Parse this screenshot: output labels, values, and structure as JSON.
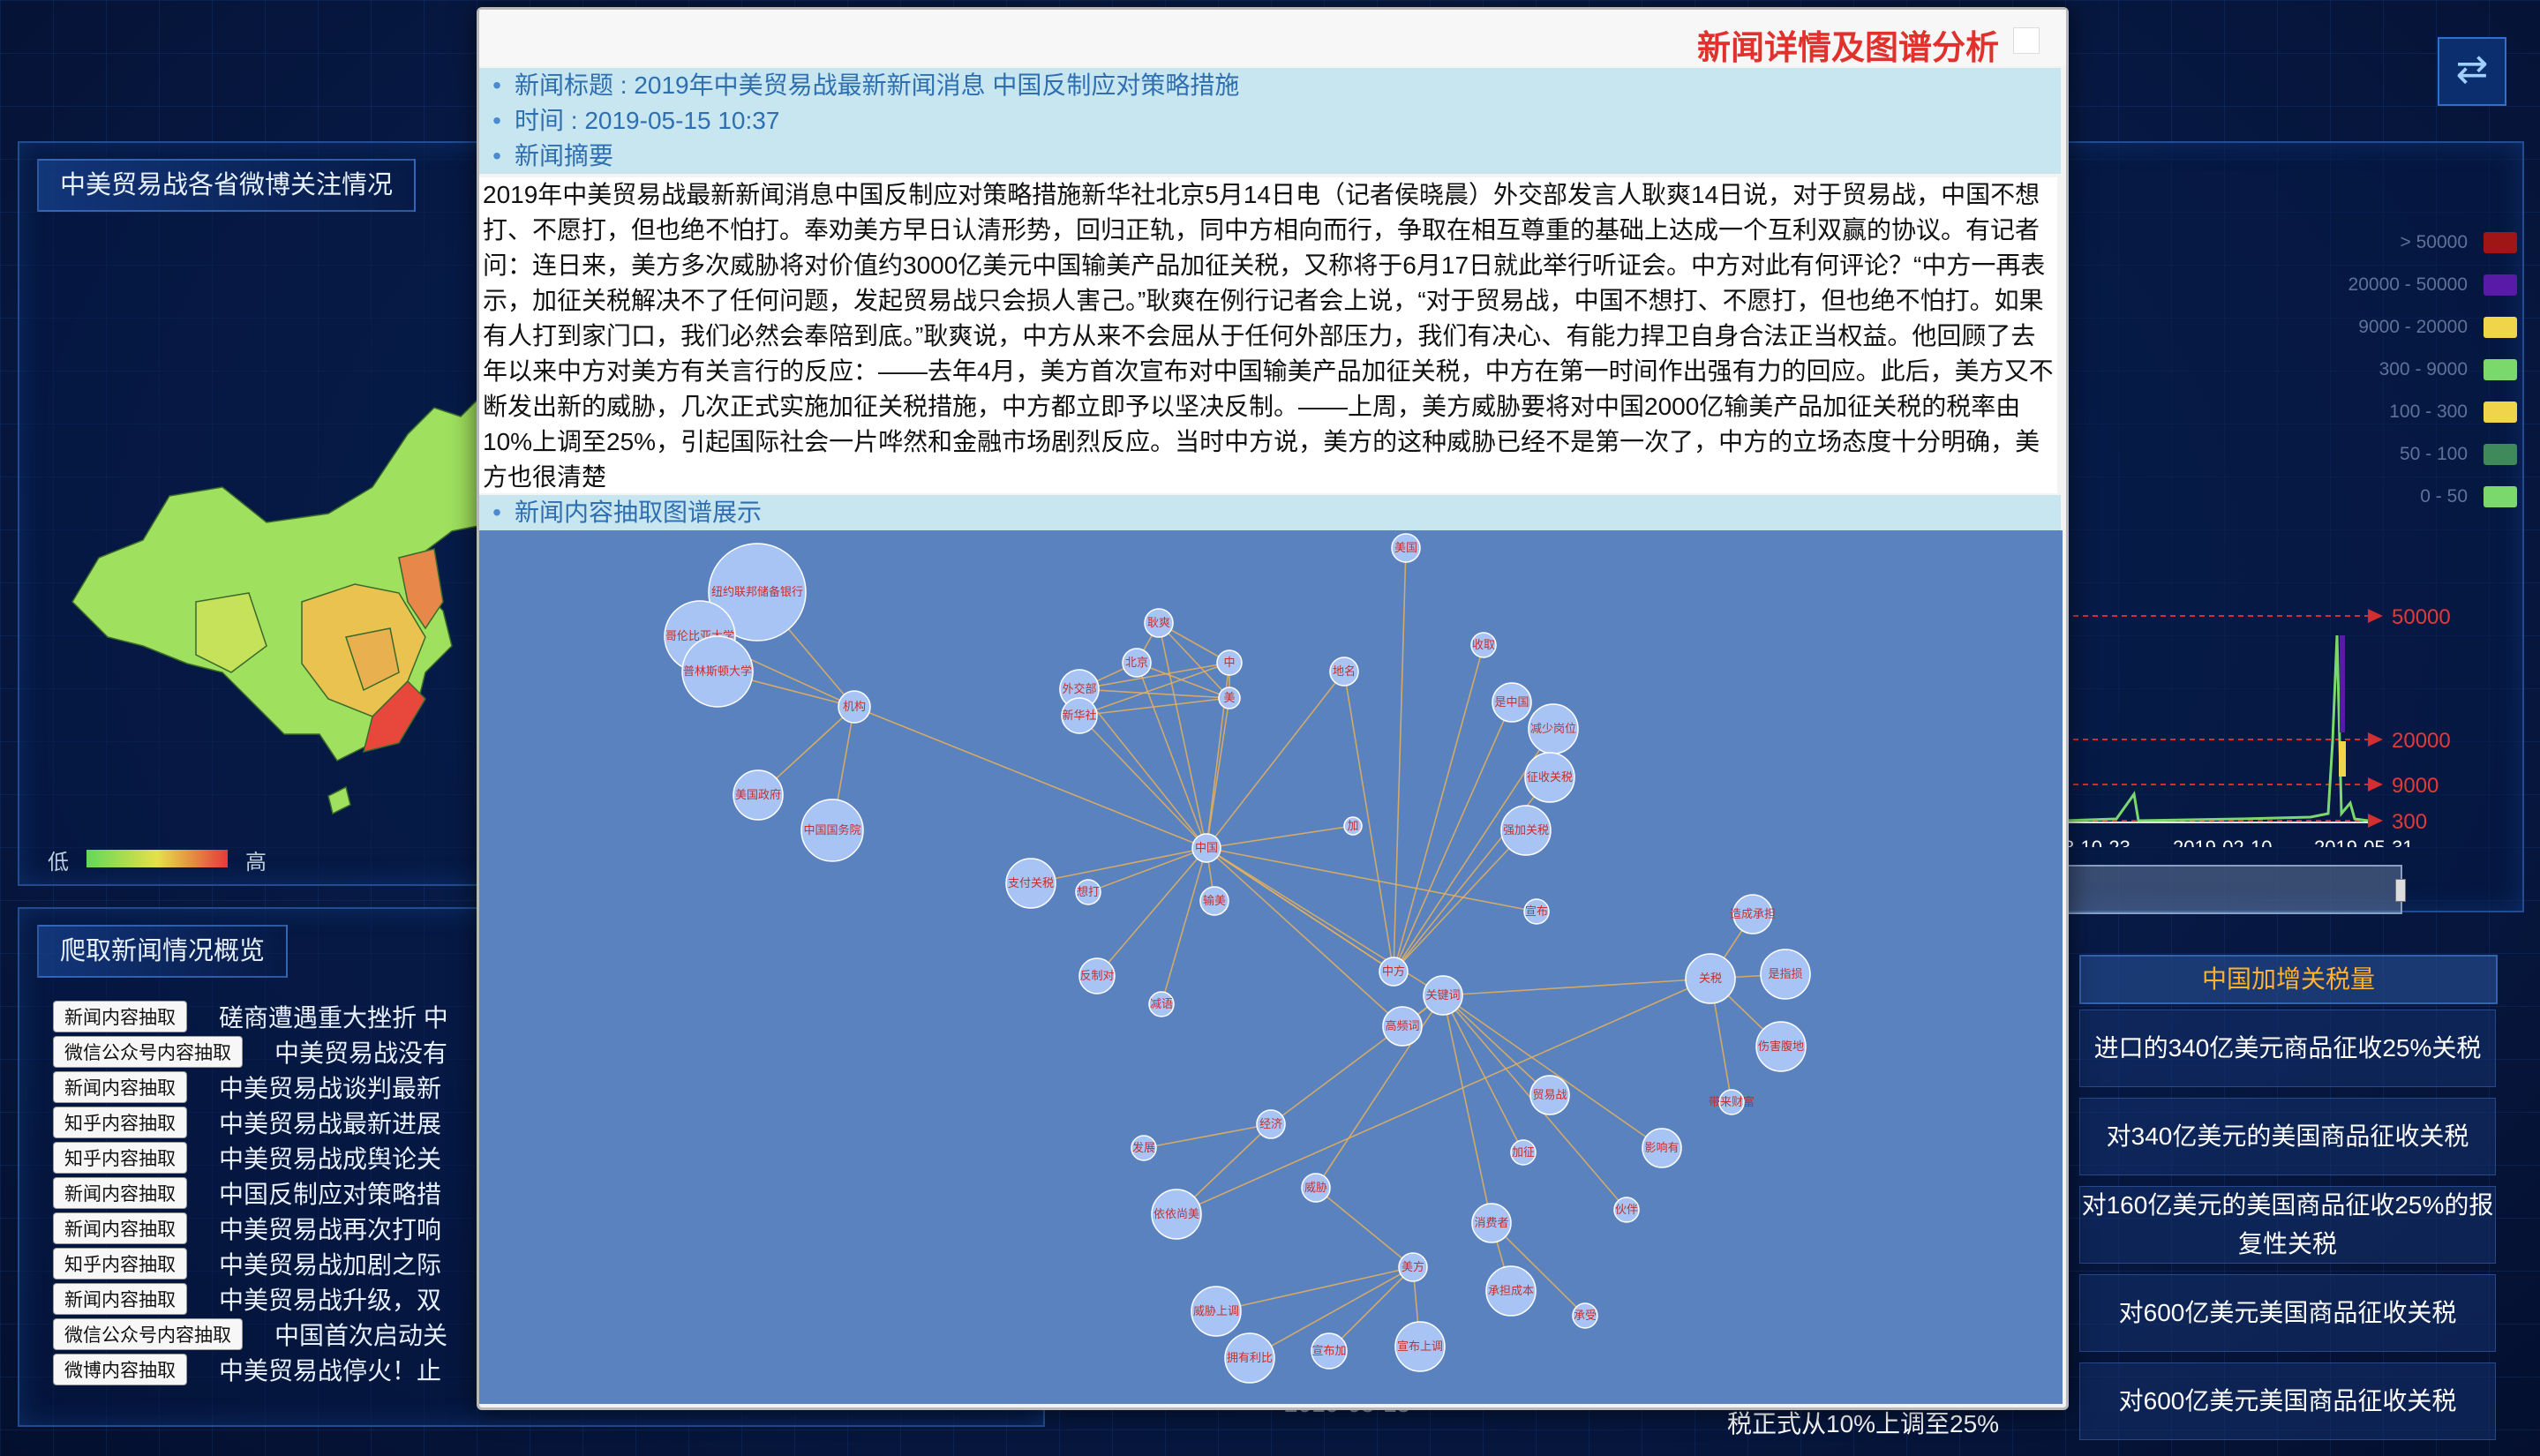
{
  "left_panel": {
    "title": "中美贸易战各省微博关注情况",
    "legend_low": "低",
    "legend_high": "高"
  },
  "news_panel": {
    "title": "爬取新闻情况概览",
    "items": [
      {
        "tag": "新闻内容抽取",
        "text": "磋商遭遇重大挫折 中"
      },
      {
        "tag": "微信公众号内容抽取",
        "text": "中美贸易战没有"
      },
      {
        "tag": "新闻内容抽取",
        "text": "中美贸易战谈判最新"
      },
      {
        "tag": "知乎内容抽取",
        "text": "中美贸易战最新进展"
      },
      {
        "tag": "知乎内容抽取",
        "text": "中美贸易战成舆论关"
      },
      {
        "tag": "新闻内容抽取",
        "text": "中国反制应对策略措"
      },
      {
        "tag": "新闻内容抽取",
        "text": "中美贸易战再次打响"
      },
      {
        "tag": "知乎内容抽取",
        "text": "中美贸易战加剧之际"
      },
      {
        "tag": "新闻内容抽取",
        "text": "中美贸易战升级，双"
      },
      {
        "tag": "微信公众号内容抽取",
        "text": "中国首次启动关"
      },
      {
        "tag": "微博内容抽取",
        "text": "中美贸易战停火！止"
      }
    ]
  },
  "top_right": {
    "swap_icon": "swap-arrows-icon",
    "legend": [
      {
        "label": "> 50000",
        "color": "#a01616"
      },
      {
        "label": "20000 - 50000",
        "color": "#5a1aa8"
      },
      {
        "label": "9000 - 20000",
        "color": "#f0d54a"
      },
      {
        "label": "300 - 9000",
        "color": "#7bd96b"
      },
      {
        "label": "100 - 300",
        "color": "#f0d54a"
      },
      {
        "label": "50 - 100",
        "color": "#3e8a5a"
      },
      {
        "label": "0 - 50",
        "color": "#7bd96b"
      }
    ],
    "chart": {
      "thresholds": [
        "50000",
        "20000",
        "9000",
        "300"
      ],
      "x_labels": [
        "8-10-23",
        "2019-02-10",
        "2019-05-31"
      ]
    }
  },
  "tariffs": {
    "title": "中国加增关税量",
    "items": [
      "进口的340亿美元商品征收25%关税",
      "对340亿美元的美国商品征收关税",
      "对160亿美元的美国商品征收25%的报复性关税",
      "对600亿美元美国商品征收关税",
      "对600亿美元美国商品征收关税"
    ]
  },
  "bottom_snippets": {
    "center": "2019-05-15",
    "right": "税正式从10%上调至25%"
  },
  "modal": {
    "title": "新闻详情及图谱分析",
    "news_title": "新闻标题 : 2019年中美贸易战最新新闻消息 中国反制应对策略措施",
    "time": "时间 : 2019-05-15 10:37",
    "abstract_label": "新闻摘要",
    "abstract": "2019年中美贸易战最新新闻消息中国反制应对策略措施新华社北京5月14日电（记者侯晓晨）外交部发言人耿爽14日说，对于贸易战，中国不想打、不愿打，但也绝不怕打。奉劝美方早日认清形势，回归正轨，同中方相向而行，争取在相互尊重的基础上达成一个互利双赢的协议。有记者问：连日来，美方多次威胁将对价值约3000亿美元中国输美产品加征关税，又称将于6月17日就此举行听证会。中方对此有何评论？“中方一再表示，加征关税解决不了任何问题，发起贸易战只会损人害己。”耿爽在例行记者会上说，“对于贸易战，中国不想打、不愿打，但也绝不怕打。如果有人打到家门口，我们必然会奉陪到底。”耿爽说，中方从来不会屈从于任何外部压力，我们有决心、有能力捍卫自身合法正当权益。他回顾了去年以来中方对美方有关言行的反应：——去年4月，美方首次宣布对中国输美产品加征关税，中方在第一时间作出强有力的回应。此后，美方又不断发出新的威胁，几次正式实施加征关税措施，中方都立即予以坚决反制。——上周，美方威胁要将对中国2000亿输美产品加征关税的税率由10%上调至25%，引起国际社会一片哗然和金融市场剧烈反应。当时中方说，美方的这种威胁已经不是第一次了，中方的立场态度十分明确，美方也很清楚",
    "graph_label": "新闻内容抽取图谱展示",
    "graph_nodes": [
      "美国",
      "纽约联邦储备银行",
      "哥伦比亚大学",
      "普林斯顿大学",
      "机构",
      "美国政府",
      "中国国务院",
      "耿爽",
      "北京",
      "外交部",
      "新华社",
      "中",
      "美",
      "地名",
      "收取",
      "是中国",
      "减少岗位",
      "征收关税",
      "强加关税",
      "中国",
      "加",
      "支付关税",
      "想打",
      "输美",
      "反制对",
      "减语",
      "宣布",
      "中方",
      "关键词",
      "高频词",
      "贸易战",
      "加征",
      "影响有",
      "伙伴",
      "消费者",
      "承担成本",
      "承受",
      "美方",
      "威胁上调",
      "拥有利比",
      "宣布加",
      "宣布上调",
      "威胁",
      "经济",
      "发展",
      "依依尚美",
      "关税",
      "造成承担",
      "是指损",
      "伤害腹地",
      "带来财富",
      "上调"
    ]
  }
}
